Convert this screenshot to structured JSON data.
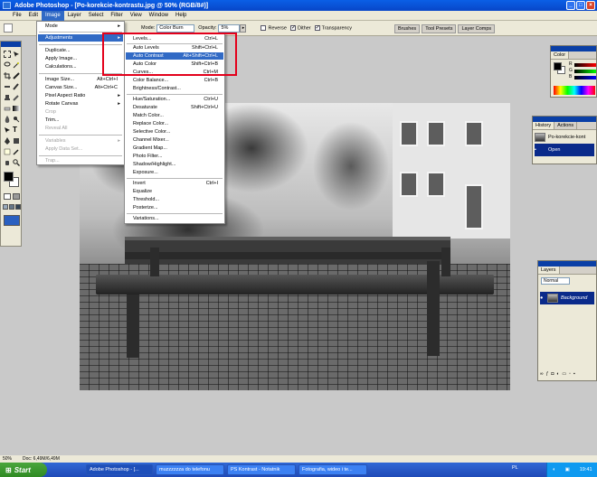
{
  "window": {
    "title": "Adobe Photoshop - [Po-korekcie-kontrastu.jpg @ 50% (RGB/8#)]",
    "min": "_",
    "max": "□",
    "close": "×"
  },
  "menubar": {
    "items": [
      "File",
      "Edit",
      "Image",
      "Layer",
      "Select",
      "Filter",
      "View",
      "Window",
      "Help"
    ]
  },
  "options": {
    "mode_label": "Mode:",
    "mode_value": "Color Burn",
    "opacity_label": "Opacity:",
    "opacity_value": "5%",
    "reverse": "Reverse",
    "dither": "Dither",
    "transparency": "Transparency"
  },
  "palette_tabs": [
    "Brushes",
    "Tool Presets",
    "Layer Comps"
  ],
  "image_menu": {
    "items": [
      {
        "label": "Mode",
        "shortcut": "",
        "arrow": "▸",
        "disabled": false,
        "hl": false
      },
      {
        "label": "Adjustments",
        "shortcut": "",
        "arrow": "▸",
        "disabled": false,
        "hl": true
      },
      {
        "label": "Duplicate...",
        "shortcut": "",
        "arrow": "",
        "disabled": false,
        "hl": false
      },
      {
        "label": "Apply Image...",
        "shortcut": "",
        "arrow": "",
        "disabled": false,
        "hl": false
      },
      {
        "label": "Calculations...",
        "shortcut": "",
        "arrow": "",
        "disabled": false,
        "hl": false
      },
      {
        "label": "Image Size...",
        "shortcut": "Alt+Ctrl+I",
        "arrow": "",
        "disabled": false,
        "hl": false
      },
      {
        "label": "Canvas Size...",
        "shortcut": "Alt+Ctrl+C",
        "arrow": "",
        "disabled": false,
        "hl": false
      },
      {
        "label": "Pixel Aspect Ratio",
        "shortcut": "",
        "arrow": "▸",
        "disabled": false,
        "hl": false
      },
      {
        "label": "Rotate Canvas",
        "shortcut": "",
        "arrow": "▸",
        "disabled": false,
        "hl": false
      },
      {
        "label": "Crop",
        "shortcut": "",
        "arrow": "",
        "disabled": true,
        "hl": false
      },
      {
        "label": "Trim...",
        "shortcut": "",
        "arrow": "",
        "disabled": false,
        "hl": false
      },
      {
        "label": "Reveal All",
        "shortcut": "",
        "arrow": "",
        "disabled": true,
        "hl": false
      },
      {
        "label": "Variables",
        "shortcut": "",
        "arrow": "▸",
        "disabled": true,
        "hl": false
      },
      {
        "label": "Apply Data Set...",
        "shortcut": "",
        "arrow": "",
        "disabled": true,
        "hl": false
      },
      {
        "label": "Trap...",
        "shortcut": "",
        "arrow": "",
        "disabled": true,
        "hl": false
      }
    ]
  },
  "adjustments_menu": {
    "items": [
      {
        "label": "Levels...",
        "shortcut": "Ctrl+L",
        "hl": false
      },
      {
        "label": "Auto Levels",
        "shortcut": "Shift+Ctrl+L",
        "hl": false
      },
      {
        "label": "Auto Contrast",
        "shortcut": "Alt+Shift+Ctrl+L",
        "hl": true
      },
      {
        "label": "Auto Color",
        "shortcut": "Shift+Ctrl+B",
        "hl": false
      },
      {
        "label": "Curves...",
        "shortcut": "Ctrl+M",
        "hl": false
      },
      {
        "label": "Color Balance...",
        "shortcut": "Ctrl+B",
        "hl": false
      },
      {
        "label": "Brightness/Contrast...",
        "shortcut": "",
        "hl": false
      },
      {
        "label": "Hue/Saturation...",
        "shortcut": "Ctrl+U",
        "hl": false
      },
      {
        "label": "Desaturate",
        "shortcut": "Shift+Ctrl+U",
        "hl": false
      },
      {
        "label": "Match Color...",
        "shortcut": "",
        "hl": false
      },
      {
        "label": "Replace Color...",
        "shortcut": "",
        "hl": false
      },
      {
        "label": "Selective Color...",
        "shortcut": "",
        "hl": false
      },
      {
        "label": "Channel Mixer...",
        "shortcut": "",
        "hl": false
      },
      {
        "label": "Gradient Map...",
        "shortcut": "",
        "hl": false
      },
      {
        "label": "Photo Filter...",
        "shortcut": "",
        "hl": false
      },
      {
        "label": "Shadow/Highlight...",
        "shortcut": "",
        "hl": false
      },
      {
        "label": "Exposure...",
        "shortcut": "",
        "hl": false
      },
      {
        "label": "Invert",
        "shortcut": "Ctrl+I",
        "hl": false
      },
      {
        "label": "Equalize",
        "shortcut": "",
        "hl": false
      },
      {
        "label": "Threshold...",
        "shortcut": "",
        "hl": false
      },
      {
        "label": "Posterize...",
        "shortcut": "",
        "hl": false
      },
      {
        "label": "Variations...",
        "shortcut": "",
        "hl": false
      }
    ]
  },
  "color_palette": {
    "tab": "Color",
    "channels": [
      "R",
      "G",
      "B"
    ]
  },
  "history_palette": {
    "tabs": [
      "History",
      "Actions"
    ],
    "snapshot": "Po-korekcie-kont",
    "state": "Open"
  },
  "layers_palette": {
    "tab": "Layers",
    "blend": "Normal",
    "layer": "Background"
  },
  "status": {
    "zoom": "50%",
    "doc": "Doc: 6,49M/6,49M"
  },
  "taskbar": {
    "start": "Start",
    "buttons": [
      "Adobe Photoshop - [...",
      "muzzzzzza do telefonu",
      "PS Kontrast - Notatnik",
      "Fotografia, wideo i te..."
    ],
    "lang": "PL",
    "clock": "19:41"
  },
  "colors": {
    "accent": "#316ac5",
    "highlight_box": "#e3001b",
    "titlebar": "#0a5fe6"
  }
}
